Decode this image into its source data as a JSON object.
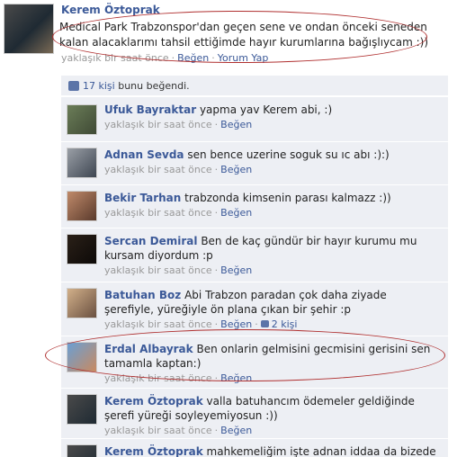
{
  "post": {
    "author": "Kerem Öztoprak",
    "text": "Medical Park Trabzonspor'dan geçen sene ve ondan önceki seneden kalan alacaklarımı tahsil ettiğimde hayır kurumlarına bağışlıycam :))",
    "time": "yaklaşık bir saat önce",
    "like_label": "Beğen",
    "comment_label": "Yorum Yap"
  },
  "likes": {
    "count_text": "17 kişi",
    "suffix": "bunu beğendi."
  },
  "comments": [
    {
      "name": "Ufuk Bayraktar",
      "text": "yapma yav Kerem abi, :)",
      "time": "yaklaşık bir saat önce",
      "like_label": "Beğen"
    },
    {
      "name": "Adnan Sevda",
      "text": "sen bence uzerine soguk su ıc abı :):)",
      "time": "yaklaşık bir saat önce",
      "like_label": "Beğen"
    },
    {
      "name": "Bekir Tarhan",
      "text": "trabzonda kimsenin parası kalmazz :))",
      "time": "yaklaşık bir saat önce",
      "like_label": "Beğen"
    },
    {
      "name": "Sercan Demiral",
      "text": "Ben de kaç gündür bir hayır kurumu mu kursam diyordum :p",
      "time": "yaklaşık bir saat önce",
      "like_label": "Beğen"
    },
    {
      "name": "Batuhan Boz",
      "text": "Abi Trabzon paradan çok daha ziyade şerefiyle, yüreğiyle ön plana çıkan bir şehir :p",
      "time": "yaklaşık bir saat önce",
      "like_label": "Beğen",
      "likes_text": "2 kişi"
    },
    {
      "name": "Erdal Albayrak",
      "text": "Ben onlarin gelmisini gecmisini gerisini sen tamamla kaptan:)",
      "time": "yaklaşık bir saat önce",
      "like_label": "Beğen"
    },
    {
      "name": "Kerem Öztoprak",
      "text": "valla batuhancım ödemeler geldiğinde şerefi yüreği soyleyemiyosun :))",
      "time": "yaklaşık bir saat önce",
      "like_label": "Beğen"
    },
    {
      "name": "Kerem Öztoprak",
      "text": "mahkemeliğim işte adnan iddaa da bizede sıra",
      "time": "",
      "like_label": ""
    }
  ],
  "colors": {
    "link": "#3b5998",
    "comment_bg": "#edeff4",
    "annotation": "#b03030"
  }
}
